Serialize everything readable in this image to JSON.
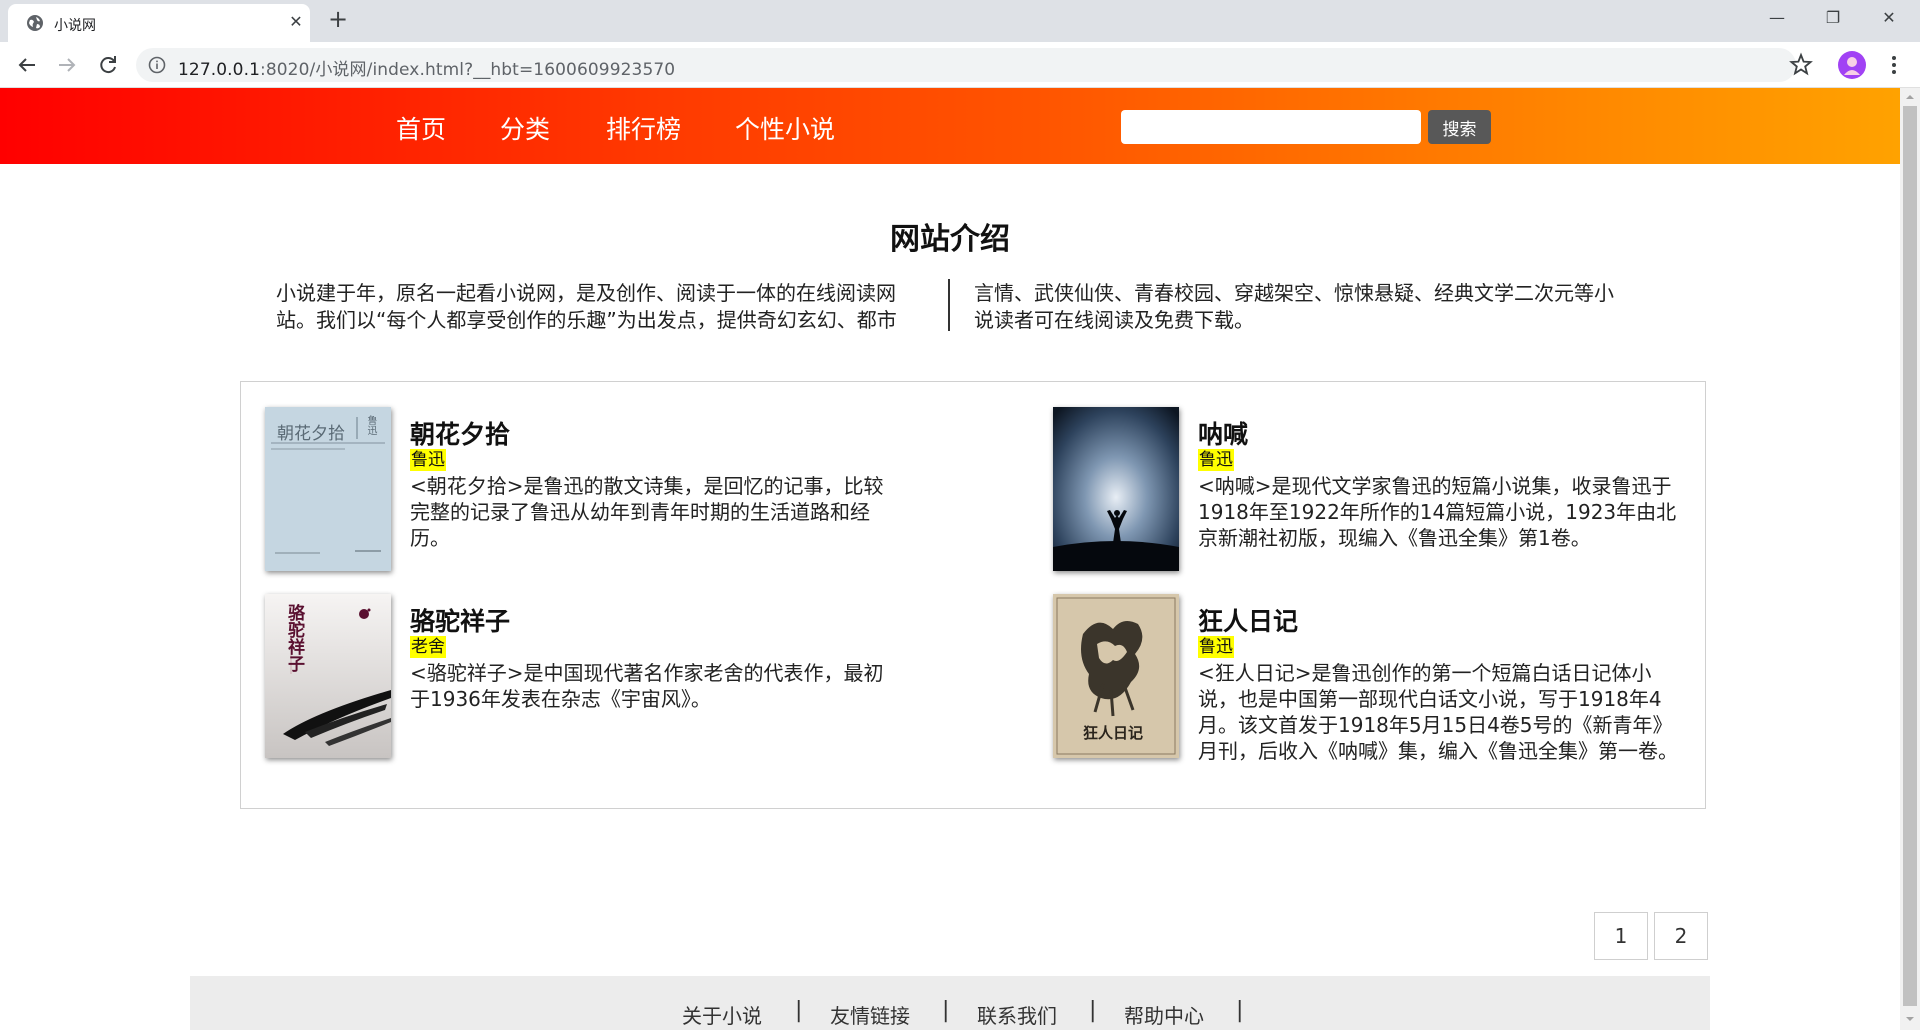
{
  "browser": {
    "tab_title": "小说网",
    "tab_close": "✕",
    "new_tab": "+",
    "url_host": "127.0.0.1",
    "url_rest": ":8020/小说网/index.html?__hbt=1600609923570",
    "window": {
      "minimize": "—",
      "restore": "❐",
      "close": "✕"
    }
  },
  "header": {
    "nav": [
      "首页",
      "分类",
      "排行榜",
      "个性小说"
    ],
    "search_placeholder": "",
    "search_button": "搜索"
  },
  "intro": {
    "title": "网站介绍",
    "left_text": "小说建于年，原名一起看小说网，是及创作、阅读于一体的在线阅读网站。我们以“每个人都享受创作的乐趣”为出发点，提供奇幻玄幻、都市",
    "right_text": "言情、武侠仙侠、青春校园、穿越架空、惊悚悬疑、经典文学二次元等小说读者可在线阅读及免费下载。"
  },
  "books": [
    {
      "title": "朝花夕拾",
      "author": "鲁迅",
      "desc": "<朝花夕拾>是鲁迅的散文诗集，是回忆的记事，比较完整的记录了鲁迅从幼年到青年时期的生活道路和经历。",
      "cover_text": "朝花夕拾",
      "cover_side": "鲁迅"
    },
    {
      "title": "呐喊",
      "author": "鲁迅",
      "desc": "<呐喊>是现代文学家鲁迅的短篇小说集，收录鲁迅于1918年至1922年所作的14篇短篇小说，1923年由北京新潮社初版，现编入《鲁迅全集》第1卷。"
    },
    {
      "title": "骆驼祥子",
      "author": "老舍",
      "desc": "<骆驼祥子>是中国现代著名作家老舍的代表作，最初于1936年发表在杂志《宇宙风》。",
      "cover_text": "骆驼祥子"
    },
    {
      "title": "狂人日记",
      "author": "鲁迅",
      "desc": "<狂人日记>是鲁迅创作的第一个短篇白话日记体小说，也是中国第一部现代白话文小说，写于1918年4月。该文首发于1918年5月15日4卷5号的《新青年》月刊，后收入《呐喊》集，编入《鲁迅全集》第一卷。",
      "cover_text": "狂人日记"
    }
  ],
  "pagination": [
    "1",
    "2"
  ],
  "footer": {
    "links": [
      "关于小说",
      "友情链接",
      "联系我们",
      "帮助中心"
    ],
    "separator": "|"
  },
  "colors": {
    "header_gradient_start": "#ff0000",
    "header_gradient_end": "#ffa200",
    "author_highlight": "#ffff00",
    "search_button_bg": "#585858"
  }
}
